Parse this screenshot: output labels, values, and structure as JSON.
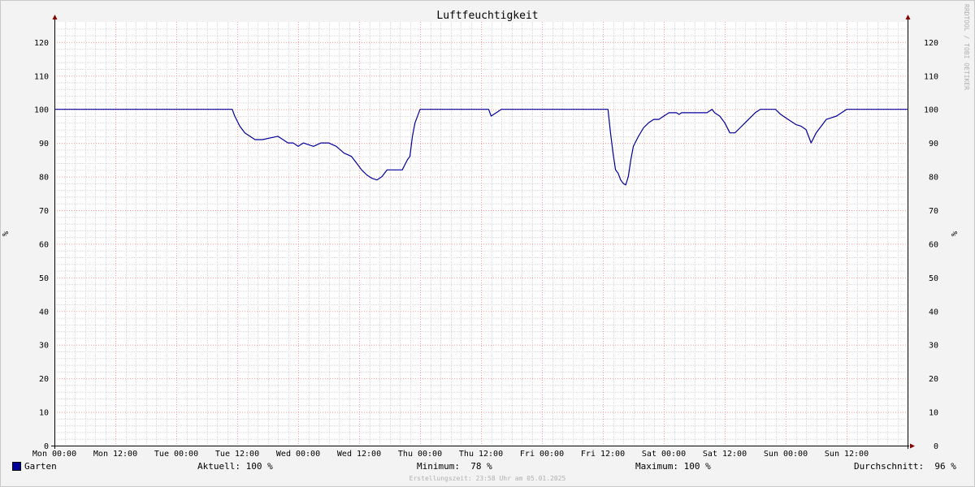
{
  "colors": {
    "line": "#000099",
    "major_grid": "#ff9999",
    "minor_grid": "#d8d8d8",
    "axis": "#000000",
    "arrow": "#800000",
    "background": "#ffffff"
  },
  "watermark": "RRDTOOL / TOBI OETIKER",
  "legend": {
    "series": "Garten",
    "current": "Aktuell: 100 %",
    "minimum": "Minimum:  78 %",
    "maximum": "Maximum: 100 %",
    "average": "Durchschnitt:  96 %"
  },
  "footer": "Erstellungszeit: 23:58 Uhr am 05.01.2025",
  "chart_data": {
    "type": "line",
    "title": "Luftfeuchtigkeit",
    "ylabel": "%",
    "ylabel_right": "%",
    "ylim": [
      0,
      126
    ],
    "yticks": [
      0,
      10,
      20,
      30,
      40,
      50,
      60,
      70,
      80,
      90,
      100,
      110,
      120
    ],
    "xlim": [
      0,
      168
    ],
    "x_unit": "hours since Mon 00:00",
    "xticks": [
      {
        "label": "Mon 00:00"
      },
      {
        "label": "Mon 12:00"
      },
      {
        "label": "Tue 00:00"
      },
      {
        "label": "Tue 12:00"
      },
      {
        "label": "Wed 00:00"
      },
      {
        "label": "Wed 12:00"
      },
      {
        "label": "Thu 00:00"
      },
      {
        "label": "Thu 12:00"
      },
      {
        "label": "Fri 00:00"
      },
      {
        "label": "Fri 12:00"
      },
      {
        "label": "Sat 00:00"
      },
      {
        "label": "Sat 12:00"
      },
      {
        "label": "Sun 00:00"
      },
      {
        "label": "Sun 12:00"
      }
    ],
    "grid": true,
    "series": [
      {
        "name": "Garten",
        "x": [
          0,
          35,
          35.5,
          36.5,
          37.5,
          38.5,
          39.5,
          41,
          42.5,
          44,
          45,
          46,
          47,
          48,
          49,
          50,
          51,
          52.5,
          54,
          55.5,
          57,
          58.5,
          59.5,
          60.5,
          61.5,
          62.5,
          63.5,
          64.5,
          65.5,
          66.5,
          67.5,
          68.5,
          69.5,
          70,
          70.5,
          71,
          72,
          74.5,
          85.5,
          86,
          87,
          88,
          109,
          109.5,
          110,
          110.5,
          111,
          111.5,
          112,
          112.5,
          113,
          113.5,
          114,
          115,
          116,
          117,
          118,
          119,
          121,
          122.5,
          123,
          123.5,
          128.5,
          129.5,
          130,
          131,
          132,
          133,
          134,
          135,
          136,
          137,
          138,
          139,
          140,
          142,
          143,
          144,
          145,
          146,
          147,
          148,
          149,
          150,
          151,
          152,
          153,
          154,
          155,
          156,
          158,
          158.5,
          168
        ],
        "y": [
          100,
          100,
          98,
          95,
          93,
          92,
          91,
          91,
          91.5,
          92,
          91,
          90,
          90,
          89,
          90,
          89.5,
          89,
          90,
          90,
          89,
          87,
          86,
          84,
          82,
          80.5,
          79.5,
          79,
          80,
          82,
          82,
          82,
          82,
          85,
          86,
          92,
          96,
          100,
          100,
          100,
          98,
          99,
          100,
          100,
          93,
          87,
          82,
          81,
          79,
          78,
          77.5,
          80,
          85,
          89,
          92,
          94.5,
          96,
          97,
          97,
          99,
          99,
          98.5,
          99,
          99,
          100,
          99,
          98,
          96,
          93,
          93,
          94.5,
          96,
          97.5,
          99,
          100,
          100,
          100,
          98.5,
          97.5,
          96.5,
          95.5,
          95,
          94,
          90,
          93,
          95,
          97,
          97.5,
          98,
          99,
          100,
          100,
          100,
          100
        ]
      }
    ]
  }
}
